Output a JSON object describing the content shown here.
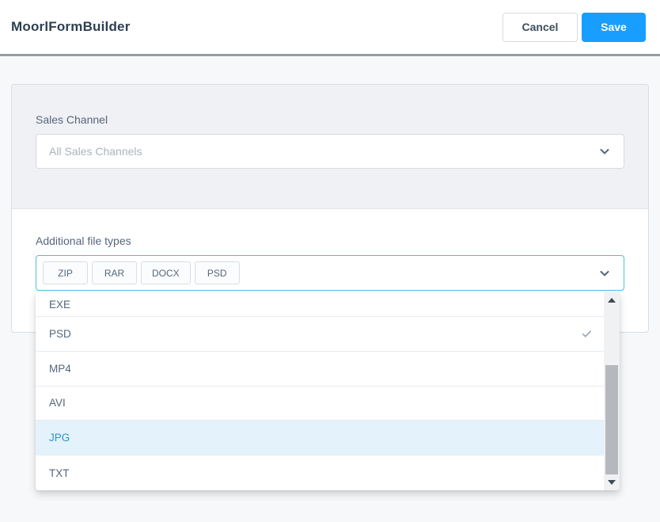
{
  "header": {
    "title": "MoorlFormBuilder",
    "cancel_label": "Cancel",
    "save_label": "Save"
  },
  "form": {
    "sales_channel": {
      "label": "Sales Channel",
      "placeholder": "All Sales Channels"
    },
    "file_types": {
      "label": "Additional file types",
      "tags": [
        "ZIP",
        "RAR",
        "DOCX",
        "PSD"
      ],
      "dropdown": {
        "items": [
          {
            "label": "EXE",
            "selected": false,
            "highlighted": false,
            "clipped_top": true
          },
          {
            "label": "PSD",
            "selected": true,
            "highlighted": false
          },
          {
            "label": "MP4",
            "selected": false,
            "highlighted": false
          },
          {
            "label": "AVI",
            "selected": false,
            "highlighted": false
          },
          {
            "label": "JPG",
            "selected": false,
            "highlighted": true
          },
          {
            "label": "TXT",
            "selected": false,
            "highlighted": false
          }
        ],
        "scrollbar_visible": true
      }
    }
  },
  "icons": {
    "chevron_down": "chevron-down",
    "check": "check",
    "scroll_up": "triangle-up",
    "scroll_down": "triangle-down"
  },
  "colors": {
    "primary": "#189eff",
    "focus_border": "#4cbfdc",
    "highlight_bg": "#e4f2fb",
    "highlight_text": "#2d93c8",
    "header_divider": "#929ca6",
    "section_gray": "#f0f1f4",
    "page_bg": "#f6f8fa",
    "title_text": "#2e3f52",
    "body_text": "#54667d",
    "placeholder_text": "#a9b4be"
  }
}
